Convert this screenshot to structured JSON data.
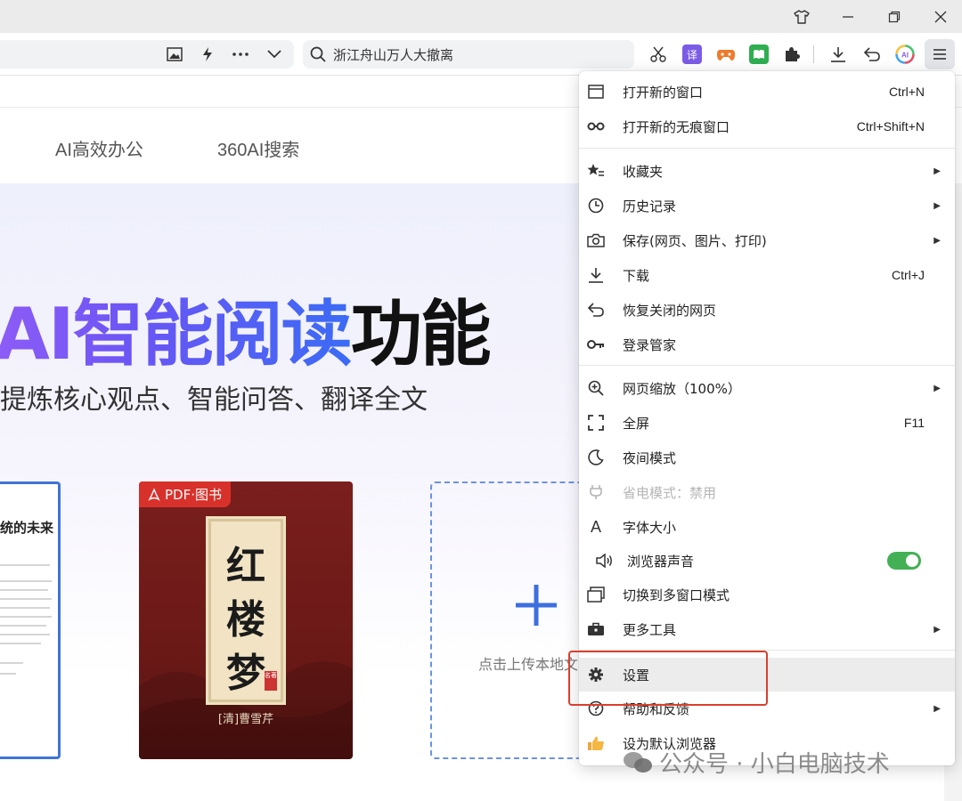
{
  "search": {
    "text": "浙江舟山万人大撤离"
  },
  "page": {
    "nav": [
      "AI高效办公",
      "360AI搜索"
    ],
    "hero_title_gradient": "AI智能阅读",
    "hero_title_dark": "功能",
    "hero_subtitle": "提炼核心观点、智能问答、翻译全文",
    "doc_card_title": "统的未来",
    "book": {
      "badge": "PDF·图书",
      "chars": [
        "红",
        "楼",
        "梦"
      ],
      "seal": "名著",
      "author": "[清]曹雪芹"
    },
    "upload_text": "点击上传本地文"
  },
  "menu": {
    "items": [
      {
        "icon": "new-window-icon",
        "label": "打开新的窗口",
        "shortcut": "Ctrl+N"
      },
      {
        "icon": "incognito-icon",
        "label": "打开新的无痕窗口",
        "shortcut": "Ctrl+Shift+N"
      },
      {
        "icon": "favorites-icon",
        "label": "收藏夹",
        "submenu": true
      },
      {
        "icon": "history-icon",
        "label": "历史记录",
        "submenu": true
      },
      {
        "icon": "camera-icon",
        "label": "保存(网页、图片、打印)",
        "submenu": true
      },
      {
        "icon": "download-icon",
        "label": "下载",
        "shortcut": "Ctrl+J"
      },
      {
        "icon": "undo-icon",
        "label": "恢复关闭的网页"
      },
      {
        "icon": "key-icon",
        "label": "登录管家"
      },
      {
        "icon": "zoom-icon",
        "label": "网页缩放（100%）",
        "submenu": true
      },
      {
        "icon": "fullscreen-icon",
        "label": "全屏",
        "shortcut": "F11"
      },
      {
        "icon": "moon-icon",
        "label": "夜间模式"
      },
      {
        "icon": "power-saver-icon",
        "label": "省电模式：禁用",
        "disabled": true
      },
      {
        "icon": "font-size-icon",
        "label": "字体大小"
      },
      {
        "icon": "speaker-icon",
        "label": "浏览器声音",
        "toggle": true
      },
      {
        "icon": "multi-window-icon",
        "label": "切换到多窗口模式"
      },
      {
        "icon": "toolbox-icon",
        "label": "更多工具",
        "submenu": true
      },
      {
        "icon": "gear-icon",
        "label": "设置",
        "highlighted": true
      },
      {
        "icon": "help-icon",
        "label": "帮助和反馈",
        "submenu": true
      },
      {
        "icon": "thumbs-up-icon",
        "label": "设为默认浏览器"
      }
    ]
  },
  "watermark": "公众号 · 小白电脑技术",
  "colors": {
    "accent_toggle": "#43b055",
    "highlight_border": "#d8402e",
    "book_red": "#6b1917"
  }
}
